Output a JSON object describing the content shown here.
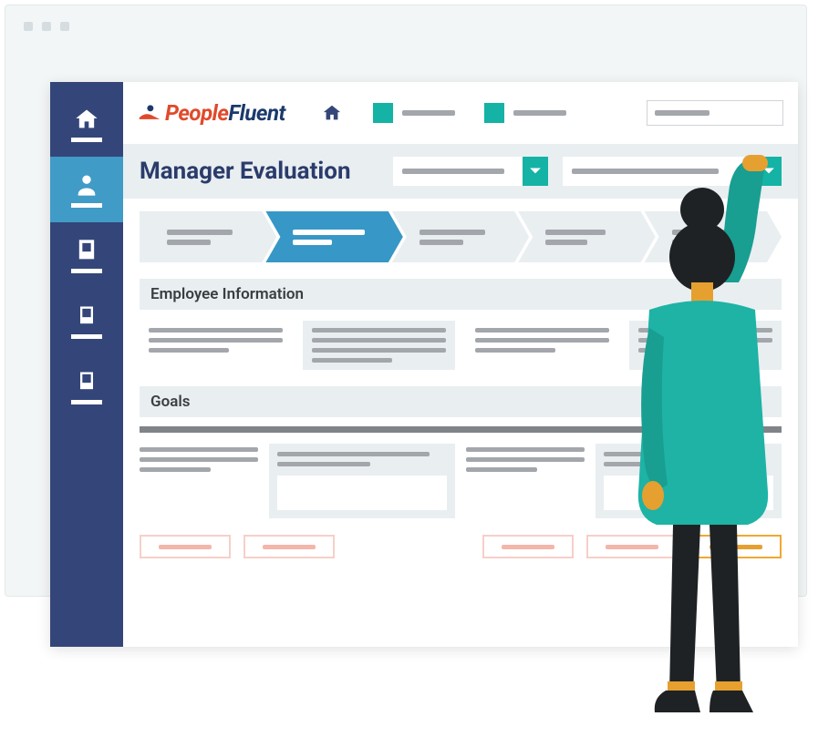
{
  "brand": {
    "people": "People",
    "fluent": "Fluent"
  },
  "page": {
    "title": "Manager Evaluation"
  },
  "sections": {
    "employee_info": "Employee Information",
    "goals": "Goals"
  },
  "colors": {
    "sidebar": "#344679",
    "accent_teal": "#14b3a5",
    "step_active": "#3797c6",
    "brand_orange": "#e04a2b",
    "brand_navy": "#1b3a6b",
    "button_pink": "#f7cfc8",
    "button_gold": "#f0a832"
  }
}
